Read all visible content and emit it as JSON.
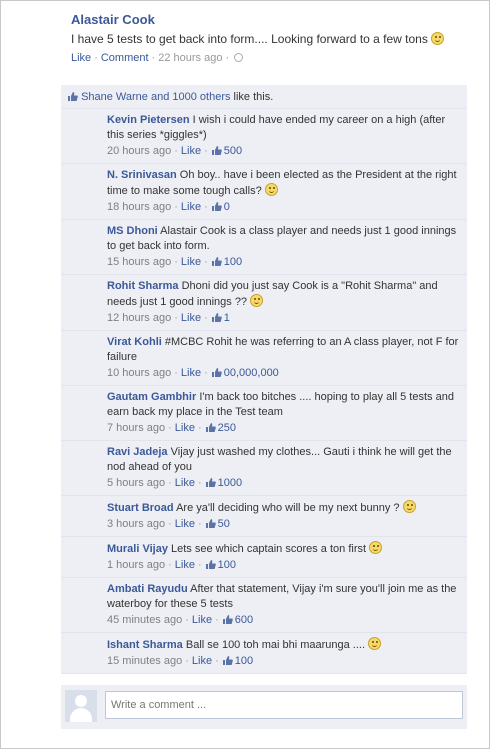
{
  "post": {
    "author": "Alastair Cook",
    "text": "I have 5 tests to get back into form.... Looking forward to a few tons",
    "like_label": "Like",
    "comment_label": "Comment",
    "time": "22 hours ago"
  },
  "likes_bar": {
    "names": "Shane Warne and 1000 others",
    "suffix": "like this."
  },
  "comment_like_label": "Like",
  "comments": [
    {
      "name": "Kevin Pietersen",
      "text": "I wish i could have ended my career on a high (after this series *giggles*)",
      "time": "20 hours ago",
      "likes": "500",
      "smiley": false
    },
    {
      "name": "N. Srinivasan",
      "text": "Oh boy.. have i been elected as the President at the right time to make some tough calls?",
      "time": "18 hours ago",
      "likes": "0",
      "smiley": true
    },
    {
      "name": "MS Dhoni",
      "text": "Alastair Cook is a class player and needs just 1 good innings to get back into form.",
      "time": "15 hours ago",
      "likes": "100",
      "smiley": false
    },
    {
      "name": "Rohit Sharma",
      "text": "Dhoni did you just say Cook is a \"Rohit Sharma\" and needs just 1 good innings ??",
      "time": "12 hours ago",
      "likes": "1",
      "smiley": true
    },
    {
      "name": "Virat Kohli",
      "text": "#MCBC Rohit he was referring to an A class player, not F for failure",
      "time": "10 hours ago",
      "likes": "00,000,000",
      "smiley": false
    },
    {
      "name": "Gautam Gambhir",
      "text": "I'm back too bitches .... hoping to play all 5 tests and earn back my place in the Test team",
      "time": "7 hours ago",
      "likes": "250",
      "smiley": false
    },
    {
      "name": "Ravi Jadeja",
      "text": "Vijay just washed my clothes... Gauti i think he will get the nod ahead of you",
      "time": "5 hours ago",
      "likes": "1000",
      "smiley": false
    },
    {
      "name": "Stuart Broad",
      "text": "Are ya'll deciding who will be my next bunny ?",
      "time": "3 hours ago",
      "likes": "50",
      "smiley": true
    },
    {
      "name": "Murali Vijay",
      "text": "Lets see which captain scores a ton first",
      "time": "1 hours ago",
      "likes": "100",
      "smiley": true
    },
    {
      "name": "Ambati Rayudu",
      "text": "After that statement, Vijay i'm sure you'll join me as the waterboy for these 5 tests",
      "time": "45 minutes ago",
      "likes": "600",
      "smiley": false
    },
    {
      "name": "Ishant Sharma",
      "text": "Ball se 100 toh mai bhi maarunga ....",
      "time": "15 minutes ago",
      "likes": "100",
      "smiley": true
    }
  ],
  "composer": {
    "placeholder": "Write a comment ..."
  }
}
